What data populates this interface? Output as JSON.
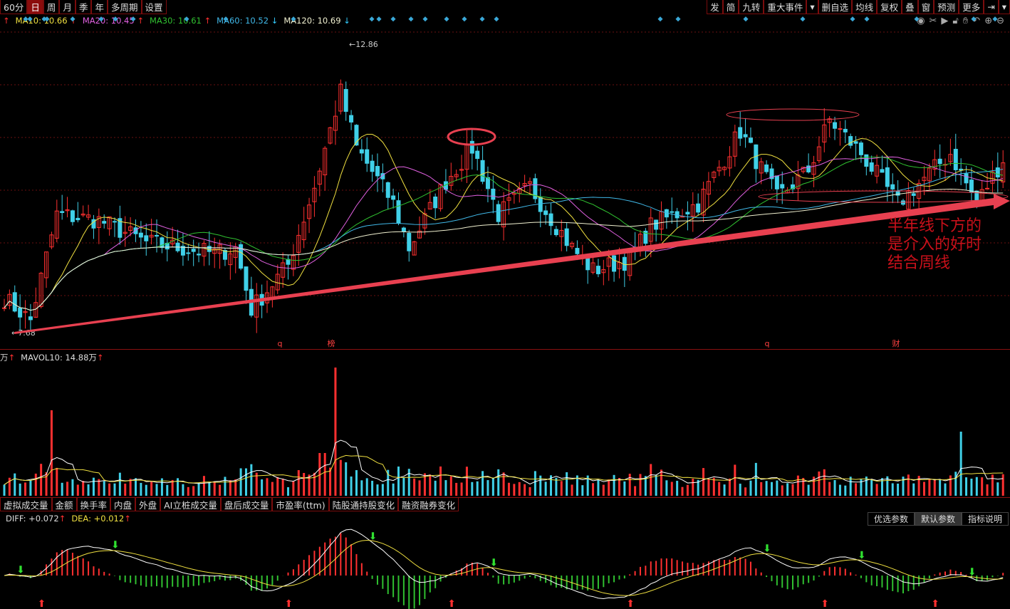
{
  "toolbar_left": [
    "60分",
    "日",
    "周",
    "月",
    "季",
    "年",
    "多周期",
    "设置"
  ],
  "toolbar_left_selected": "日",
  "toolbar_right": [
    "发",
    "简",
    "九转",
    "重大事件",
    "▾",
    "删自选",
    "均线",
    "复权",
    "叠",
    "窗",
    "预测",
    "更多",
    "⇥",
    "▾"
  ],
  "chart_icons": [
    "eye-icon",
    "scissors-icon",
    "play-icon",
    "lock-icon",
    "hand-icon",
    "undo-icon",
    "zoom-in-icon",
    "zoom-out-icon"
  ],
  "ma_legend": [
    {
      "label": "MA10: 10.66",
      "arrow": "↑",
      "color": "#f0e040"
    },
    {
      "label": "MA20: 10.45",
      "arrow": "↑",
      "color": "#e060e0"
    },
    {
      "label": "MA30: 10.61",
      "arrow": "↑",
      "color": "#30c030"
    },
    {
      "label": "MA60: 10.52",
      "arrow": "↓",
      "color": "#40b8e8"
    },
    {
      "label": "MA120: 10.69",
      "arrow": "↓",
      "color": "#f0f0d0"
    }
  ],
  "price_high_label": "12.86",
  "price_low_label": "7.68",
  "price_high": 12.86,
  "price_low": 7.68,
  "event_markers": [
    {
      "label": "q",
      "pos": 393
    },
    {
      "label": "榜",
      "pos": 465
    },
    {
      "label": "q",
      "pos": 1077
    },
    {
      "label": "财",
      "pos": 1258
    }
  ],
  "price_path": [
    [
      0,
      8.3
    ],
    [
      5,
      7.9
    ],
    [
      10,
      9.8
    ],
    [
      18,
      9.7
    ],
    [
      27,
      9.3
    ],
    [
      40,
      9.1
    ],
    [
      44,
      9.2
    ],
    [
      47,
      8.1
    ],
    [
      54,
      8.9
    ],
    [
      59,
      10.3
    ],
    [
      64,
      12.0
    ],
    [
      67,
      11.0
    ],
    [
      74,
      10.0
    ],
    [
      77,
      9.2
    ],
    [
      84,
      10.4
    ],
    [
      89,
      11.0
    ],
    [
      94,
      9.8
    ],
    [
      100,
      10.3
    ],
    [
      108,
      9.2
    ],
    [
      112,
      8.8
    ],
    [
      119,
      9.0
    ],
    [
      123,
      9.6
    ],
    [
      132,
      10.0
    ],
    [
      140,
      11.3
    ],
    [
      147,
      10.1
    ],
    [
      153,
      10.6
    ],
    [
      157,
      11.5
    ],
    [
      163,
      10.9
    ],
    [
      170,
      10.0
    ],
    [
      180,
      10.9
    ],
    [
      185,
      10.0
    ],
    [
      190,
      10.8
    ]
  ],
  "annotation": [
    "半年线下方的",
    "是介入的好时",
    "结合周线"
  ],
  "volume_legend": {
    "prefix": "万",
    "arrow1": "↑",
    "label": "MAVOL10: 14.88万",
    "arrow2": "↑"
  },
  "indicator_tabs": [
    "虚拟成交量",
    "金额",
    "换手率",
    "内盘",
    "外盘",
    "AI立桩成交量",
    "盘后成交量",
    "市盈率(ttm)",
    "陆股通持股变化",
    "融资融券变化"
  ],
  "macd_legend": {
    "diff": "DIFF: +0.072",
    "dea": "DEA: +0.012",
    "arrow": "↑"
  },
  "param_buttons": [
    "优选参数",
    "默认参数",
    "指标说明"
  ],
  "colors": {
    "up": "#ff3030",
    "down": "#40d0e8",
    "grid": "#8a1010",
    "trend": "#e84050"
  }
}
